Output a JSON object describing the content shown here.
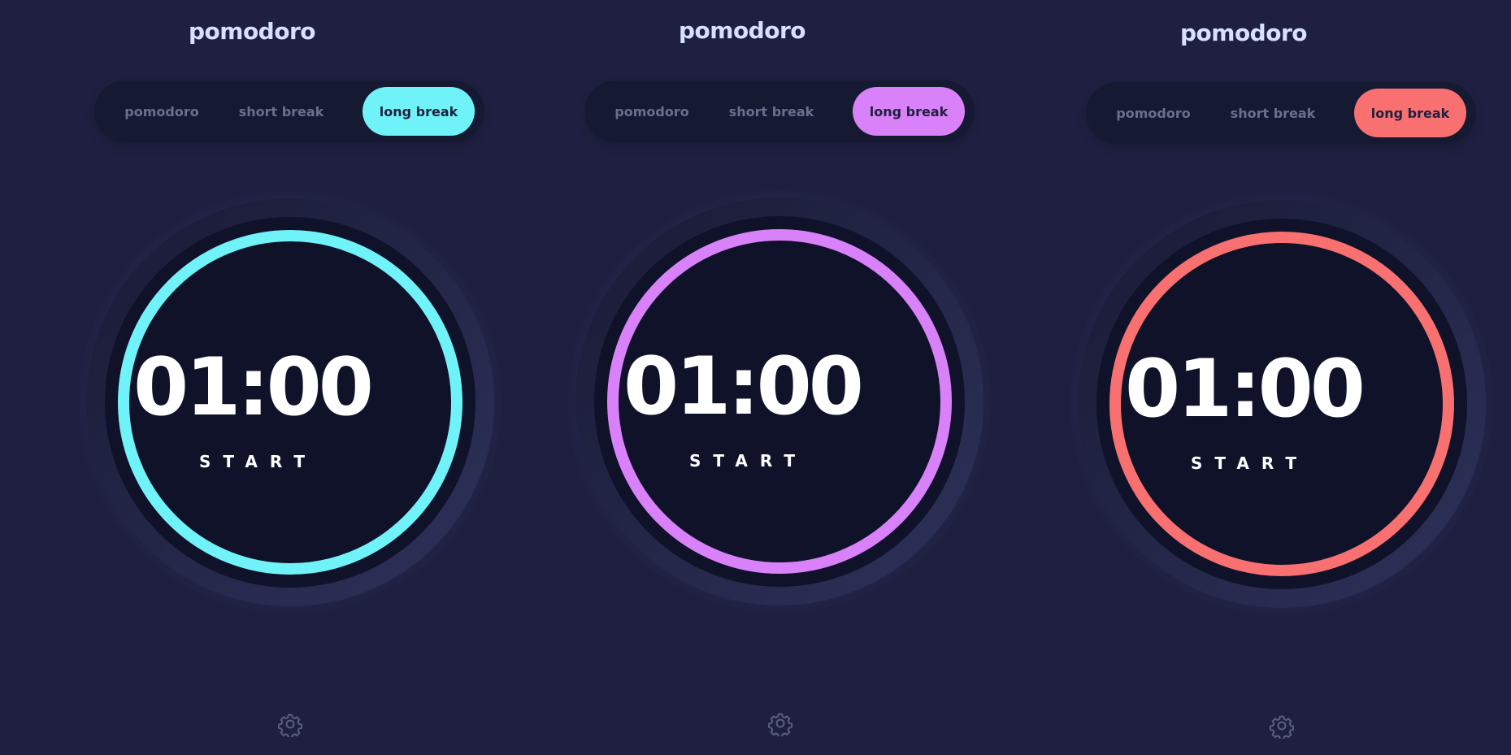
{
  "panels": [
    {
      "title": "pomodoro",
      "tabs": [
        "pomodoro",
        "short break",
        "long break"
      ],
      "active_tab": "long break",
      "accent": "#70f3f8",
      "time": "01:00",
      "action": "START",
      "settings_icon": "gear-icon"
    },
    {
      "title": "pomodoro",
      "tabs": [
        "pomodoro",
        "short break",
        "long break"
      ],
      "active_tab": "long break",
      "accent": "#d881f8",
      "time": "01:00",
      "action": "START",
      "settings_icon": "gear-icon"
    },
    {
      "title": "pomodoro",
      "tabs": [
        "pomodoro",
        "short break",
        "long break"
      ],
      "active_tab": "long break",
      "accent": "#f87070",
      "time": "01:00",
      "action": "START",
      "settings_icon": "gear-icon"
    }
  ],
  "colors": {
    "background": "#1f2041",
    "title": "#d7e0fe",
    "tab_inactive_text": "#6b6f8f",
    "tab_active_text": "#1e213f",
    "timer_face": "#0f1229"
  }
}
